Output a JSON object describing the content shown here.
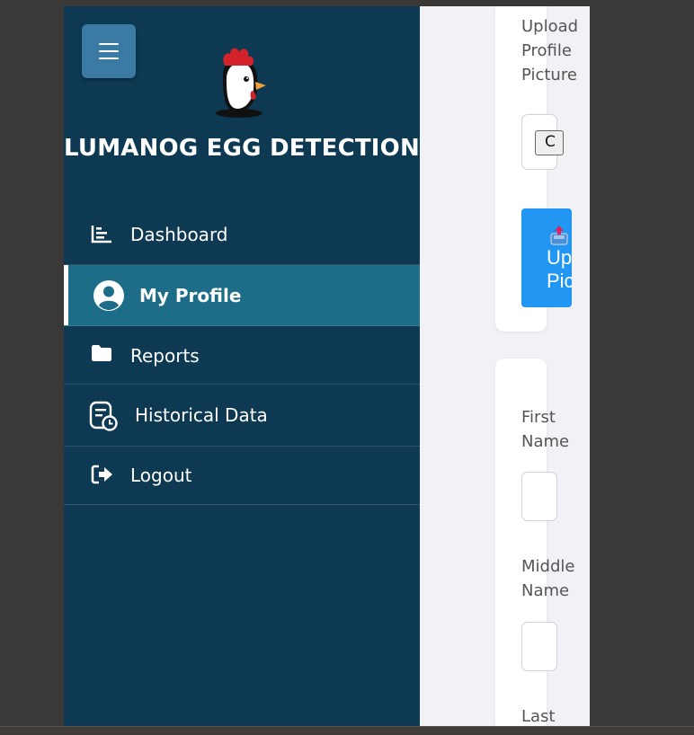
{
  "sidebar": {
    "menu_icon": "hamburger-icon",
    "logo_icon": "chicken-logo-icon",
    "title": "LUMANOG EGG DETECTION",
    "items": [
      {
        "label": "Dashboard",
        "icon": "bar-chart-icon",
        "active": false
      },
      {
        "label": "My Profile",
        "icon": "user-circle-icon",
        "active": true
      },
      {
        "label": "Reports",
        "icon": "folder-icon",
        "active": false
      },
      {
        "label": "Historical Data",
        "icon": "history-document-icon",
        "active": false
      },
      {
        "label": "Logout",
        "icon": "logout-icon",
        "active": false
      }
    ]
  },
  "profile_picture": {
    "label": "Upload Profile Picture",
    "upload_button_label": "Upload Picture",
    "upload_icon": "inbox-upload-icon"
  },
  "personal_info": {
    "first_name_label": "First Name",
    "middle_name_label": "Middle Name",
    "last_name_label": "Last"
  },
  "colors": {
    "sidebar_bg": "#0d3a52",
    "active_item_bg": "#1d6d88",
    "menu_button_bg": "#3a7aa3",
    "upload_button_bg": "#2196f3",
    "content_bg": "#f1f1f6"
  }
}
